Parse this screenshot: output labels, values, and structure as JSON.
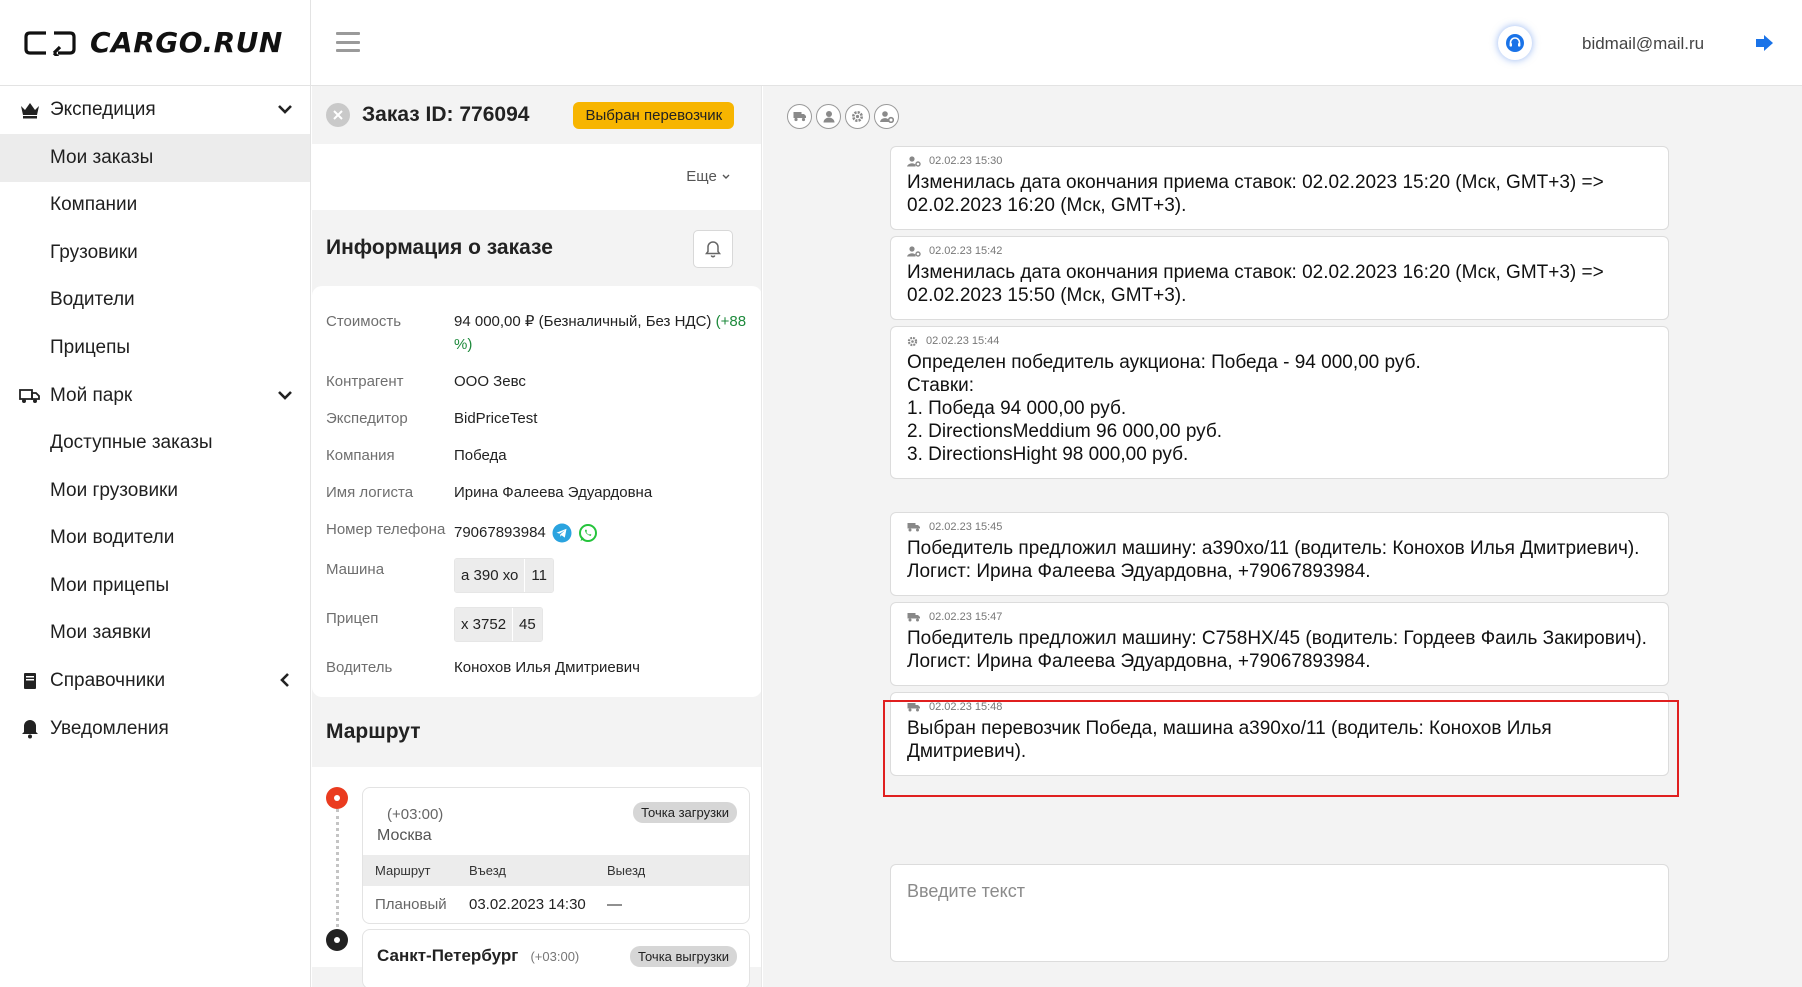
{
  "brand": {
    "name": "CARGO.RUN"
  },
  "header": {
    "user_email": "bidmail@mail.ru",
    "accent_color": "#1a73e8"
  },
  "sidebar": {
    "groups": [
      {
        "label": "Экспедиция",
        "icon": "crown-icon",
        "expanded": true,
        "items": [
          "Мои заказы",
          "Компании",
          "Грузовики",
          "Водители",
          "Прицепы"
        ]
      },
      {
        "label": "Мой парк",
        "icon": "truck-icon",
        "expanded": true,
        "items": [
          "Доступные заказы",
          "Мои грузовики",
          "Мои водители",
          "Мои прицепы",
          "Мои заявки"
        ]
      },
      {
        "label": "Справочники",
        "icon": "book-icon",
        "expanded": false
      },
      {
        "label": "Уведомления",
        "icon": "bell-icon",
        "expanded": false
      }
    ],
    "active_item": "Мои заказы"
  },
  "order": {
    "title": "Заказ ID: 776094",
    "status": "Выбран перевозчик",
    "status_color": "#f7b500",
    "more_label": "Еще",
    "info_title": "Информация о заказе",
    "fields": {
      "cost_label": "Стоимость",
      "cost_value": "94 000,00 ₽ (Безналичный, Без НДС)",
      "cost_delta": "(+88 %)",
      "counterparty_label": "Контрагент",
      "counterparty_value": "ООО Зевс",
      "forwarder_label": "Экспедитор",
      "forwarder_value": "BidPriceTest",
      "company_label": "Компания",
      "company_value": "Победа",
      "logist_label": "Имя логиста",
      "logist_value": "Ирина Фалеева Эдуардовна",
      "phone_label": "Номер телефона",
      "phone_value": "79067893984",
      "truck_label": "Машина",
      "truck_plate": "а 390 хо",
      "truck_region": "11",
      "trailer_label": "Прицеп",
      "trailer_plate": "х 3752",
      "trailer_region": "45",
      "driver_label": "Водитель",
      "driver_value": "Конохов Илья Дмитриевич"
    },
    "route": {
      "title": "Маршрут",
      "points": [
        {
          "tz": "(+03:00)",
          "city": "Москва",
          "tag": "Точка загрузки",
          "table_headers": [
            "Маршрут",
            "Въезд",
            "Выезд"
          ],
          "row": [
            "Плановый",
            "03.02.2023 14:30",
            "—"
          ]
        },
        {
          "tz": "(+03:00)",
          "city": "Санкт-Петербург",
          "tag": "Точка выгрузки"
        }
      ]
    }
  },
  "log": {
    "messages": [
      {
        "icon": "user-gear-icon",
        "time": "02.02.23 15:30",
        "text": "Изменилась дата окончания приема ставок: 02.02.2023 15:20 (Мск, GMT+3) =>\n02.02.2023 16:20 (Мск, GMT+3)."
      },
      {
        "icon": "user-gear-icon",
        "time": "02.02.23 15:42",
        "text": "Изменилась дата окончания приема ставок: 02.02.2023 16:20 (Мск, GMT+3) =>\n02.02.2023 15:50 (Мск, GMT+3)."
      },
      {
        "icon": "gear-icon",
        "time": "02.02.23 15:44",
        "text": "Определен победитель аукциона: Победа - 94 000,00 руб.\nСтавки:\n1. Победа 94 000,00 руб.\n2. DirectionsMeddium 96 000,00 руб.\n3. DirectionsHight 98 000,00 руб."
      },
      {
        "icon": "truck-icon",
        "time": "02.02.23 15:45",
        "text": "Победитель предложил машину: а390хо/11 (водитель: Конохов Илья Дмитриевич).\nЛогист: Ирина Фалеева Эдуардовна, +79067893984."
      },
      {
        "icon": "truck-icon",
        "time": "02.02.23 15:47",
        "text": "Победитель предложил машину: C758HX/45 (водитель: Гордеев Фаиль Закирович).\nЛогист: Ирина Фалеева Эдуардовна, +79067893984."
      },
      {
        "icon": "truck-icon",
        "time": "02.02.23 15:48",
        "text": "Выбран перевозчик Победа, машина а390хо/11 (водитель: Конохов Илья\nДмитриевич)."
      }
    ],
    "composer_placeholder": "Введите текст",
    "highlight_color": "#e01f1f"
  }
}
